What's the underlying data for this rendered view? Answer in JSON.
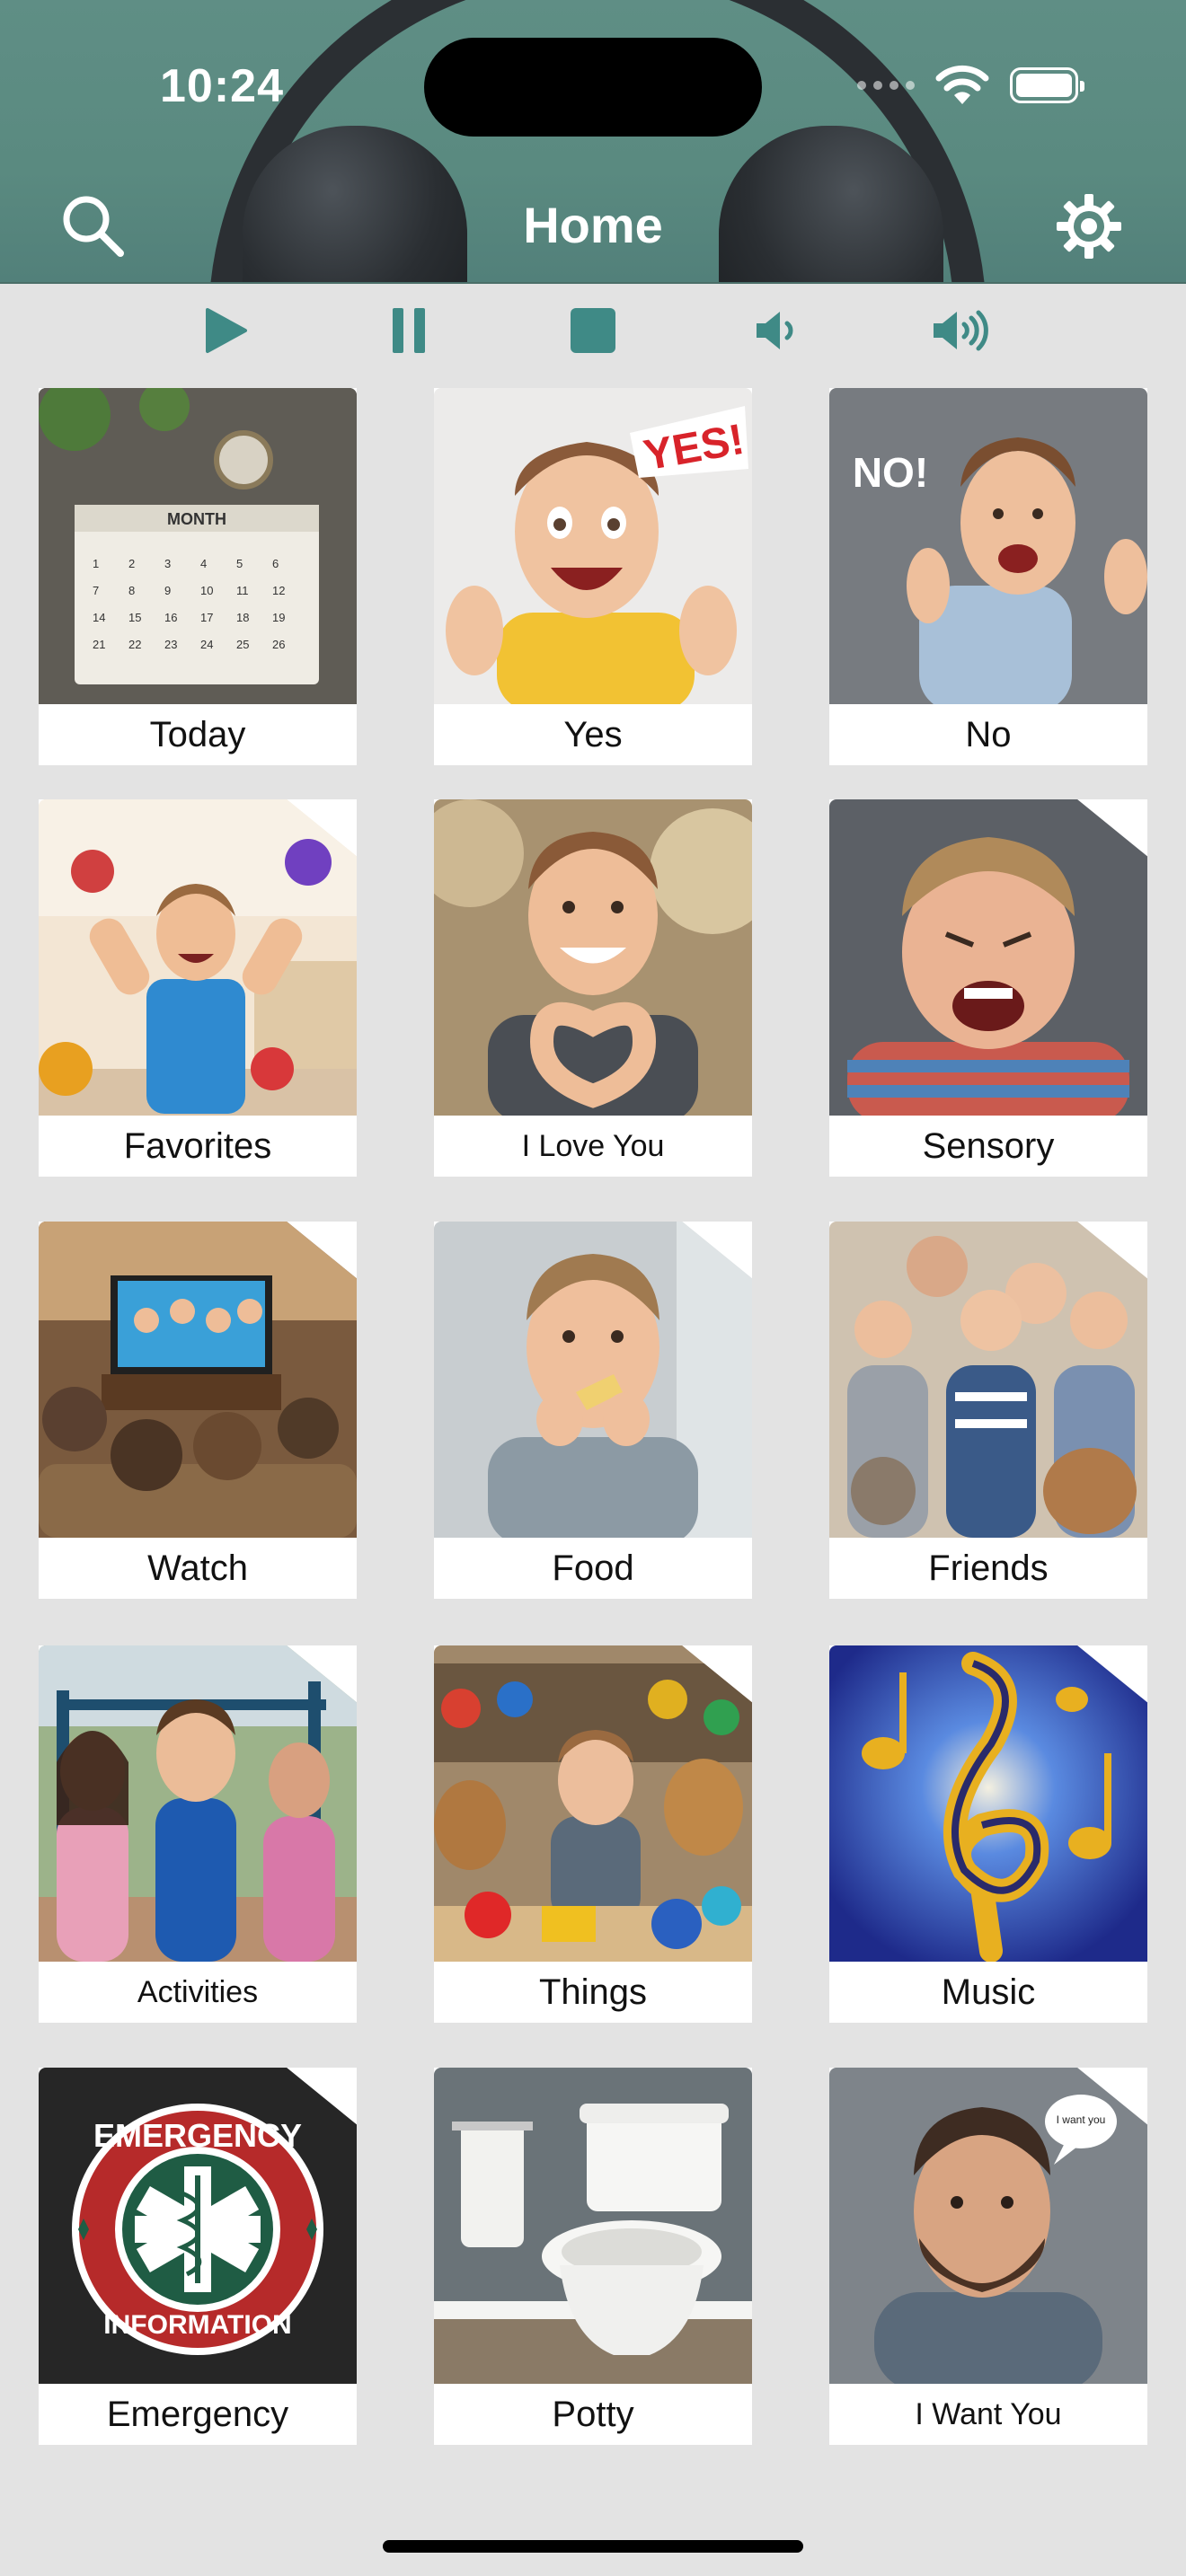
{
  "status_bar": {
    "time": "10:24"
  },
  "header": {
    "title": "Home"
  },
  "toolbar": {
    "icons": [
      "search-icon",
      "gear-icon",
      "play-icon",
      "pause-icon",
      "stop-icon",
      "volume-down-icon",
      "volume-up-icon"
    ]
  },
  "colors": {
    "accent": "#3f8a86",
    "header": "#5a8a80"
  },
  "grid": [
    {
      "label": "Today"
    },
    {
      "label": "Yes"
    },
    {
      "label": "No"
    },
    {
      "label": "Favorites"
    },
    {
      "label": "I Love You"
    },
    {
      "label": "Sensory"
    },
    {
      "label": "Watch"
    },
    {
      "label": "Food"
    },
    {
      "label": "Friends"
    },
    {
      "label": "Activities"
    },
    {
      "label": "Things"
    },
    {
      "label": "Music"
    },
    {
      "label": "Emergency"
    },
    {
      "label": "Potty"
    },
    {
      "label": "I Want You"
    }
  ],
  "pictures": {
    "today_month": "MONTH",
    "yes_sign": "YES!",
    "no_sign": "NO!",
    "emergency_top": "EMERGENCY",
    "emergency_bottom": "INFORMATION",
    "speech": "I want you"
  }
}
